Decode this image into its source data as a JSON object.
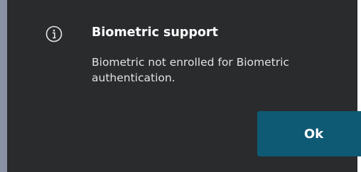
{
  "dialog": {
    "icon": "info-icon",
    "title": "Biometric support",
    "message": "Biometric not enrolled for Biometric authentication.",
    "ok_label": "Ok"
  },
  "colors": {
    "dialog_background": "#2a2b2c",
    "backdrop": "#8a91a5",
    "button_background": "#0e5a74",
    "title_text": "#ffffff",
    "message_text": "#e2e2e2"
  }
}
